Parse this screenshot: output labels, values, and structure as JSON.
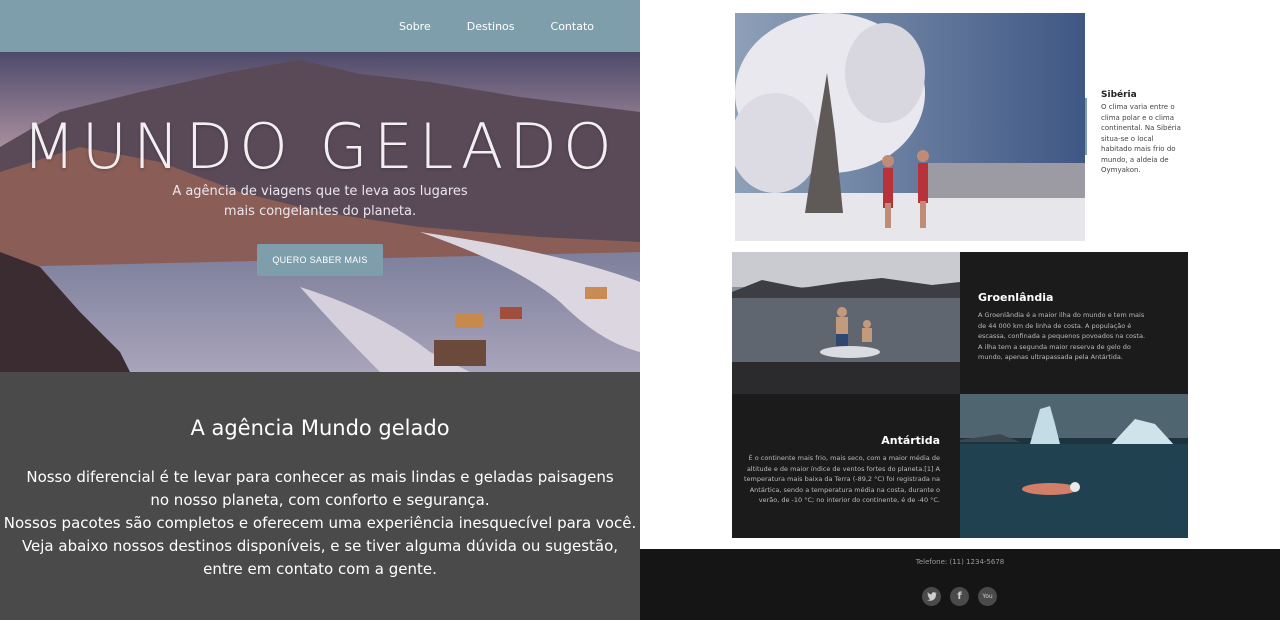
{
  "nav": {
    "items": [
      "Sobre",
      "Destinos",
      "Contato"
    ]
  },
  "hero": {
    "title": "MUNDO GELADO",
    "subtitle_line1": "A agência de viagens que te leva aos lugares",
    "subtitle_line2": "mais congelantes do planeta.",
    "button_label": "QUERO SABER MAIS"
  },
  "about": {
    "title": "A agência Mundo gelado",
    "lines": [
      "Nosso diferencial é te levar para conhecer as mais lindas e geladas paisagens",
      "no nosso planeta, com conforto e segurança.",
      "Nossos pacotes são completos e oferecem uma experiência inesquecível para você.",
      "Veja abaixo nossos destinos disponíveis, e se tiver alguma dúvida ou sugestão,",
      "entre em contato com a gente."
    ]
  },
  "destinations": {
    "siberia": {
      "title": "Sibéria",
      "text": "O clima varia entre o clima polar e o clima continental. Na Sibéria situa-se o local habitado mais frio do mundo, a aldeia de Oymyakon."
    },
    "greenland": {
      "title": "Groenlândia",
      "text": "A Groenlândia é a maior ilha do mundo e tem mais de 44 000 km de linha de costa. A população é escassa, confinada a pequenos povoados na costa. A ilha tem a segunda maior reserva de gelo do mundo, apenas ultrapassada pela Antártida."
    },
    "antarctica": {
      "title": "Antártida",
      "text": "É o continente mais frio, mais seco, com a maior média de altitude e de maior índice de ventos fortes do planeta.[1] A temperatura mais baixa da Terra (-89,2 °C) foi registrada na Antártica, sendo a temperatura média na costa, durante o verão, de -10 °C; no interior do continente, é de -40 °C."
    }
  },
  "footer": {
    "phone": "Telefone: (11) 1234-5678",
    "socials": [
      {
        "icon": "twitter-icon",
        "glyph": "🐦"
      },
      {
        "icon": "facebook-icon",
        "glyph": "f"
      },
      {
        "icon": "youtube-icon",
        "glyph": "You"
      }
    ]
  },
  "colors": {
    "accent": "#7f9eab",
    "dark_panel": "#4a4a4a",
    "grid_bg": "#1b1b1b",
    "footer_bg": "#151515"
  }
}
